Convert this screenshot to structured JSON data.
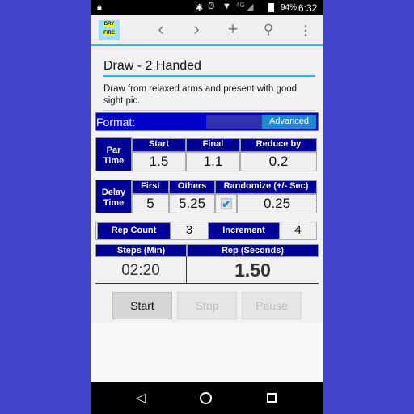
{
  "status": {
    "battery": "94%",
    "time": "6:32",
    "network": "4G"
  },
  "actionbar": {
    "logo_text": "DRY FIRE",
    "icons": [
      "chevron-left-icon",
      "chevron-right-icon",
      "plus-icon",
      "search-icon",
      "overflow-menu-icon"
    ]
  },
  "drill": {
    "title": "Draw - 2 Handed",
    "description": "Draw from relaxed arms and present with good sight pic."
  },
  "format": {
    "label": "Format:",
    "option": "Advanced"
  },
  "par_time": {
    "label_1": "Par",
    "label_2": "Time",
    "headers": [
      "Start",
      "Final",
      "Reduce by"
    ],
    "values": [
      "1.5",
      "1.1",
      "0.2"
    ]
  },
  "delay_time": {
    "label_1": "Delay",
    "label_2": "Time",
    "headers": [
      "First",
      "Others",
      "Randomize (+/- Sec)"
    ],
    "values": [
      "5",
      "5.25",
      "0.25"
    ],
    "randomize_checked": true
  },
  "rep": {
    "count_label": "Rep Count",
    "count": "3",
    "increment_label": "Increment",
    "increment": "4"
  },
  "summary": {
    "steps_label": "Steps (Min)",
    "steps": "02:20",
    "rep_label": "Rep (Seconds)",
    "rep": "1.50"
  },
  "buttons": {
    "start": "Start",
    "stop": "Stop",
    "pause": "Pause"
  },
  "colors": {
    "background": "#3f45cc",
    "header": "#000096",
    "accent": "#33b5e5"
  }
}
